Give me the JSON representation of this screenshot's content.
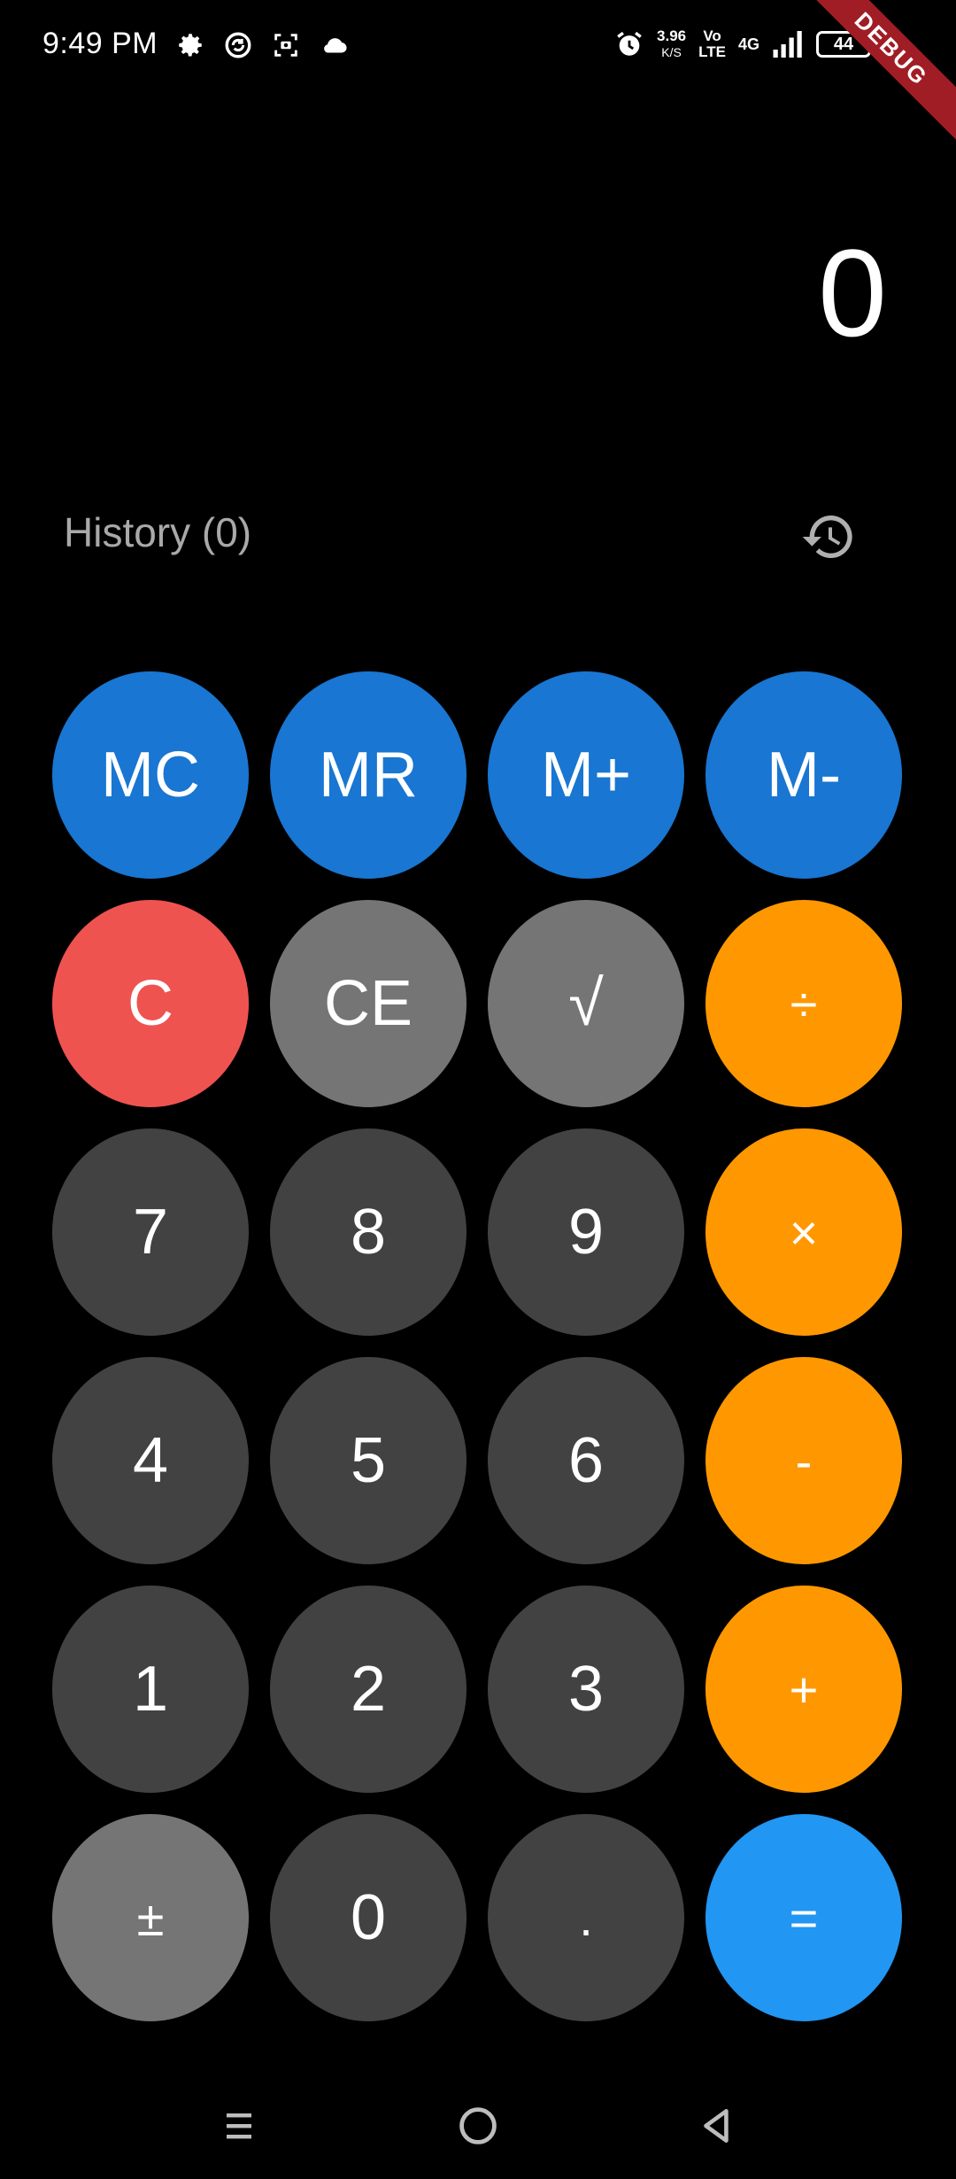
{
  "status_bar": {
    "time": "9:49 PM",
    "left_icons": [
      "gear-icon",
      "sync-icon",
      "screenshot-icon",
      "cloud-icon"
    ],
    "net_speed_value": "3.96",
    "net_speed_unit": "K/S",
    "volte_top": "Vo",
    "volte_bottom": "LTE",
    "network": "4G",
    "battery": "44",
    "right_icons": [
      "alarm-icon",
      "signal-icon",
      "charging-icon"
    ]
  },
  "debug_banner": "DEBUG",
  "display": {
    "value": "0"
  },
  "history": {
    "label": "History (0)",
    "icon": "history-icon"
  },
  "keypad": {
    "rows": [
      [
        {
          "label": "MC",
          "type": "memory"
        },
        {
          "label": "MR",
          "type": "memory"
        },
        {
          "label": "M+",
          "type": "memory"
        },
        {
          "label": "M-",
          "type": "memory"
        }
      ],
      [
        {
          "label": "C",
          "type": "clear"
        },
        {
          "label": "CE",
          "type": "function"
        },
        {
          "label": "√",
          "type": "function"
        },
        {
          "label": "÷",
          "type": "operator"
        }
      ],
      [
        {
          "label": "7",
          "type": "digit"
        },
        {
          "label": "8",
          "type": "digit"
        },
        {
          "label": "9",
          "type": "digit"
        },
        {
          "label": "×",
          "type": "operator"
        }
      ],
      [
        {
          "label": "4",
          "type": "digit"
        },
        {
          "label": "5",
          "type": "digit"
        },
        {
          "label": "6",
          "type": "digit"
        },
        {
          "label": "-",
          "type": "operator"
        }
      ],
      [
        {
          "label": "1",
          "type": "digit"
        },
        {
          "label": "2",
          "type": "digit"
        },
        {
          "label": "3",
          "type": "digit"
        },
        {
          "label": "+",
          "type": "operator"
        }
      ],
      [
        {
          "label": "±",
          "type": "function"
        },
        {
          "label": "0",
          "type": "digit"
        },
        {
          "label": ".",
          "type": "digit"
        },
        {
          "label": "=",
          "type": "equals"
        }
      ]
    ]
  },
  "colors": {
    "memory": "#1976d2",
    "clear": "#ef5350",
    "function": "#757575",
    "digit": "#424242",
    "operator": "#ff9800",
    "equals": "#2196f3",
    "background": "#000000"
  },
  "nav_bar": {
    "icons": [
      "menu-icon",
      "home-icon",
      "back-icon"
    ]
  }
}
